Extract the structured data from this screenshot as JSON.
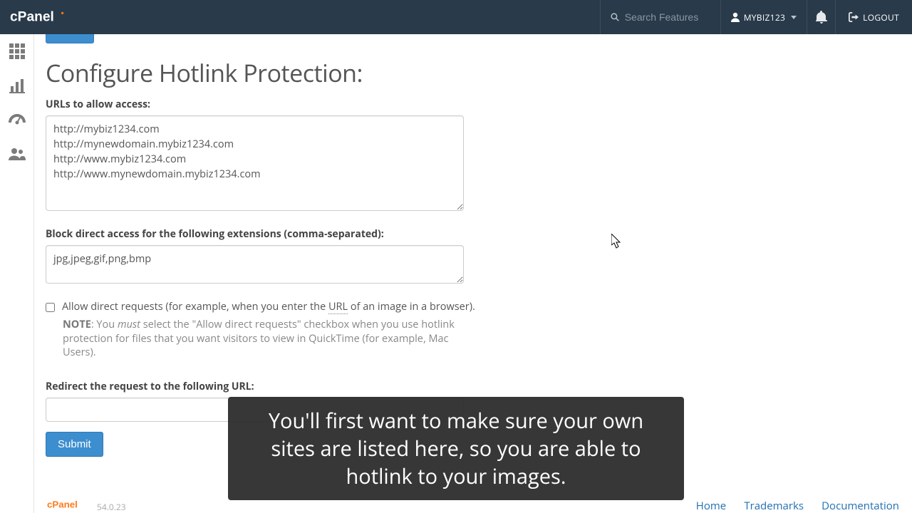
{
  "header": {
    "search_placeholder": "Search Features",
    "username": "MYBIZ123",
    "logout_label": "LOGOUT"
  },
  "page": {
    "title": "Configure Hotlink Protection:",
    "urls_label": "URLs to allow access:",
    "urls_value": "http://mybiz1234.com\nhttp://mynewdomain.mybiz1234.com\nhttp://www.mybiz1234.com\nhttp://www.mynewdomain.mybiz1234.com",
    "ext_label": "Block direct access for the following extensions (comma-separated):",
    "ext_value": "jpg,jpeg,gif,png,bmp",
    "allow_label_pre": "Allow direct requests (for example, when you enter the ",
    "allow_label_url": "URL",
    "allow_label_post": " of an image in a browser).",
    "note_label": "NOTE",
    "note_colon": ": You ",
    "note_must": "must",
    "note_rest": " select the \"Allow direct requests\" checkbox when you use hotlink protection for files that you want visitors to view in QuickTime (for example, Mac Users).",
    "redirect_label": "Redirect the request to the following URL:",
    "redirect_value": "",
    "submit_label": "Submit"
  },
  "footer": {
    "version": "54.0.23",
    "links": {
      "home": "Home",
      "trademarks": "Trademarks",
      "docs": "Documentation"
    }
  },
  "caption": "You'll first want to make sure your own sites are listed here, so you are able to hotlink to your images."
}
